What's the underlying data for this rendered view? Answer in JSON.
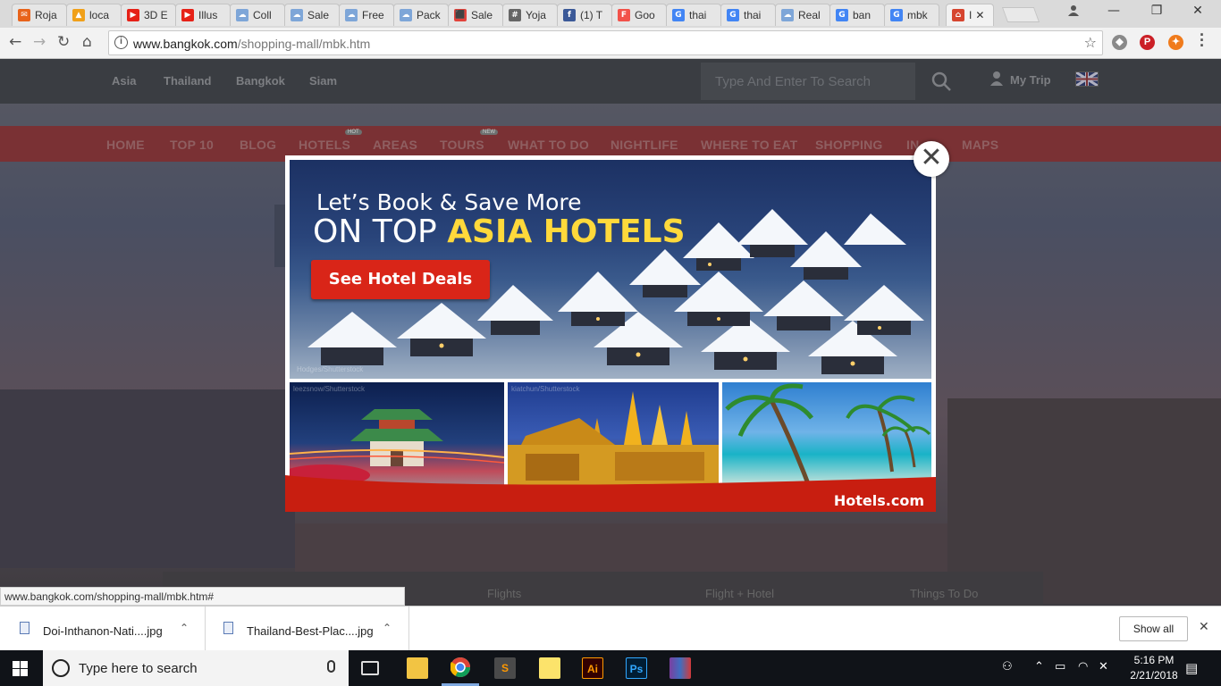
{
  "browser": {
    "tabs": [
      {
        "label": "Roja",
        "icon": "rojadirecta-icon",
        "color": "#e8631a"
      },
      {
        "label": "loca",
        "icon": "pma-icon",
        "color": "#f0a019"
      },
      {
        "label": "3D E",
        "icon": "youtube-icon",
        "color": "#e62117"
      },
      {
        "label": "Illus",
        "icon": "youtube-icon",
        "color": "#e62117"
      },
      {
        "label": "Coll",
        "icon": "cloud-doc-icon",
        "color": "#7ea6d8"
      },
      {
        "label": "Sale",
        "icon": "cloud-doc-icon",
        "color": "#7ea6d8"
      },
      {
        "label": "Free",
        "icon": "cloud-doc-icon",
        "color": "#7ea6d8"
      },
      {
        "label": "Pack",
        "icon": "cloud-doc-icon",
        "color": "#7ea6d8"
      },
      {
        "label": "Sale",
        "icon": "sale-icon",
        "color": "#e2433b"
      },
      {
        "label": "Yoja",
        "icon": "hash-icon",
        "color": "#666666"
      },
      {
        "label": "(1) T",
        "icon": "facebook-icon",
        "color": "#3b5998"
      },
      {
        "label": "Goo",
        "icon": "fiverr-icon",
        "color": "#f2524a"
      },
      {
        "label": "thai",
        "icon": "google-icon",
        "color": "#4285f4"
      },
      {
        "label": "thai",
        "icon": "google-icon",
        "color": "#4285f4"
      },
      {
        "label": "Real",
        "icon": "cloud-doc-icon",
        "color": "#7ea6d8"
      },
      {
        "label": "ban",
        "icon": "google-icon",
        "color": "#4285f4"
      },
      {
        "label": "mbk",
        "icon": "google-icon",
        "color": "#4285f4"
      },
      {
        "label": "I",
        "icon": "bangkok-icon",
        "color": "#d6452f"
      }
    ],
    "url_host": "www.bangkok.com",
    "url_path": "/shopping-mall/mbk.htm",
    "status_url": "www.bangkok.com/shopping-mall/mbk.htm#"
  },
  "site": {
    "breadcrumbs": [
      "Asia",
      "Thailand",
      "Bangkok",
      "Siam"
    ],
    "search_placeholder": "Type And Enter To Search",
    "my_trip": "My Trip",
    "nav": [
      "HOME",
      "TOP 10",
      "BLOG",
      "HOTELS",
      "AREAS",
      "TOURS",
      "WHAT TO DO",
      "NIGHTLIFE",
      "WHERE TO EAT",
      "SHOPPING",
      "IN",
      "MAPS"
    ],
    "nav_badges": {
      "hotels": "HOT",
      "tours": "NEW"
    },
    "bottom_tabs": [
      "Flights",
      "Flight + Hotel",
      "Things To Do"
    ]
  },
  "ad": {
    "tagline_line1": "Let’s Book & Save More",
    "tagline_line2_prefix": "ON TOP ",
    "tagline_line2_highlight": "ASIA HOTELS",
    "cta": "See Hotel Deals",
    "brand": "Hotels.com",
    "credits": [
      "Hodges/Shutterstock",
      "leezsnow/Shutterstock",
      "kiatchun/Shutterstock"
    ],
    "accent_color": "#d92518",
    "highlight_color": "#ffd93b"
  },
  "downloads": {
    "items": [
      "Doi-Inthanon-Nati....jpg",
      "Thailand-Best-Plac....jpg"
    ],
    "show_all": "Show all"
  },
  "taskbar": {
    "search_placeholder": "Type here to search",
    "apps": [
      "task-view",
      "file-explorer",
      "chrome",
      "sublime-text",
      "sticky-notes",
      "illustrator",
      "photoshop",
      "winrar"
    ],
    "time": "5:16 PM",
    "date": "2/21/2018"
  }
}
